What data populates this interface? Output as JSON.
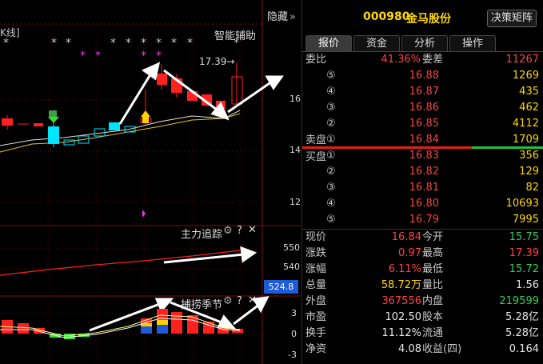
{
  "chart": {
    "hide_label": "隐藏",
    "hide_arrow": "»",
    "left_label": "K线]",
    "indicator_main": "智能辅助",
    "price_note": "17.39→",
    "axis_main": [
      "16",
      "14",
      "12"
    ],
    "sub1_title": "主力追踪",
    "sub1_axis": [
      "550",
      "540"
    ],
    "sub1_current": "524.8",
    "sub2_title": "捕捞季节",
    "sub2_axis": [
      "3",
      "0",
      "-3"
    ],
    "tool_icons": [
      "gear-icon",
      "help-icon",
      "close-icon"
    ]
  },
  "quote": {
    "code": "000980",
    "name": "金马股份",
    "decision_button": "决策矩阵",
    "tabs": [
      "报价",
      "资金",
      "分析",
      "操作"
    ],
    "webi_label": "委比",
    "webi_value": "41.36%",
    "weicha_label": "委差",
    "weicha_value": "11267",
    "sell_label": "卖盘",
    "buy_label": "买盘",
    "sell": [
      {
        "idx": "⑤",
        "price": "16.88",
        "vol": "1269"
      },
      {
        "idx": "④",
        "price": "16.87",
        "vol": "435"
      },
      {
        "idx": "③",
        "price": "16.86",
        "vol": "462"
      },
      {
        "idx": "②",
        "price": "16.85",
        "vol": "4112"
      },
      {
        "idx": "①",
        "price": "16.84",
        "vol": "1709"
      }
    ],
    "buy": [
      {
        "idx": "①",
        "price": "16.83",
        "vol": "356"
      },
      {
        "idx": "②",
        "price": "16.82",
        "vol": "129"
      },
      {
        "idx": "③",
        "price": "16.81",
        "vol": "82"
      },
      {
        "idx": "④",
        "price": "16.80",
        "vol": "10693"
      },
      {
        "idx": "⑤",
        "price": "16.79",
        "vol": "7995"
      }
    ],
    "stats": [
      {
        "l1": "现价",
        "v1": "16.84",
        "c1": "red",
        "l2": "今开",
        "v2": "15.75",
        "c2": "green"
      },
      {
        "l1": "涨跌",
        "v1": "0.97",
        "c1": "red",
        "l2": "最高",
        "v2": "17.39",
        "c2": "red"
      },
      {
        "l1": "涨幅",
        "v1": "6.11%",
        "c1": "red",
        "l2": "最低",
        "v2": "15.72",
        "c2": "green"
      },
      {
        "l1": "总量",
        "v1": "58.72万",
        "c1": "yellow",
        "l2": "量比",
        "v2": "1.56",
        "c2": "white"
      },
      {
        "l1": "外盘",
        "v1": "367556",
        "c1": "red",
        "l2": "内盘",
        "v2": "219599",
        "c2": "green"
      },
      {
        "l1": "市盈",
        "v1": "102.50",
        "c1": "white",
        "l2": "股本",
        "v2": "5.28亿",
        "c2": "white"
      },
      {
        "l1": "换手",
        "v1": "11.12%",
        "c1": "white",
        "l2": "流通",
        "v2": "5.28亿",
        "c2": "white"
      },
      {
        "l1": "净资",
        "v1": "4.08",
        "c1": "white",
        "l2": "收益(四)",
        "v2": "0.164",
        "c2": "white"
      }
    ]
  },
  "colors": {
    "up": "#ff2020",
    "down": "#00e5ff",
    "accent_blue": "#1e5bd8",
    "ma": "#ffff80"
  }
}
